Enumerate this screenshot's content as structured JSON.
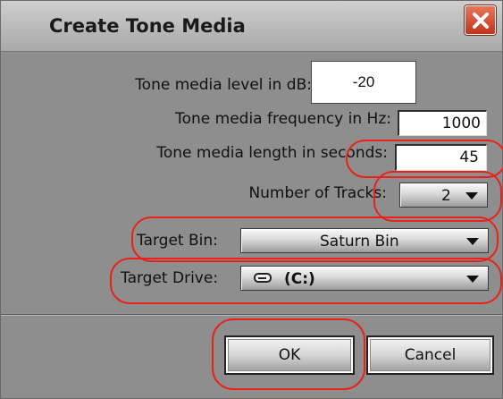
{
  "dialog": {
    "title": "Create Tone Media",
    "colors": {
      "background": "#8e8e8e",
      "callout": "#e8211a",
      "close": "#d2452a"
    }
  },
  "form": {
    "level": {
      "label": "Tone media level in dB:",
      "value": "-20"
    },
    "frequency": {
      "label": "Tone media frequency in Hz:",
      "value": "1000"
    },
    "length": {
      "label": "Tone media length in seconds:",
      "value": "45"
    },
    "tracks": {
      "label": "Number of Tracks:",
      "value": "2"
    },
    "target_bin": {
      "label": "Target Bin:",
      "value": "Saturn Bin"
    },
    "target_drive": {
      "label": "Target Drive:",
      "value": "(C:)",
      "icon": "drive-icon"
    }
  },
  "buttons": {
    "ok": "OK",
    "cancel": "Cancel"
  }
}
